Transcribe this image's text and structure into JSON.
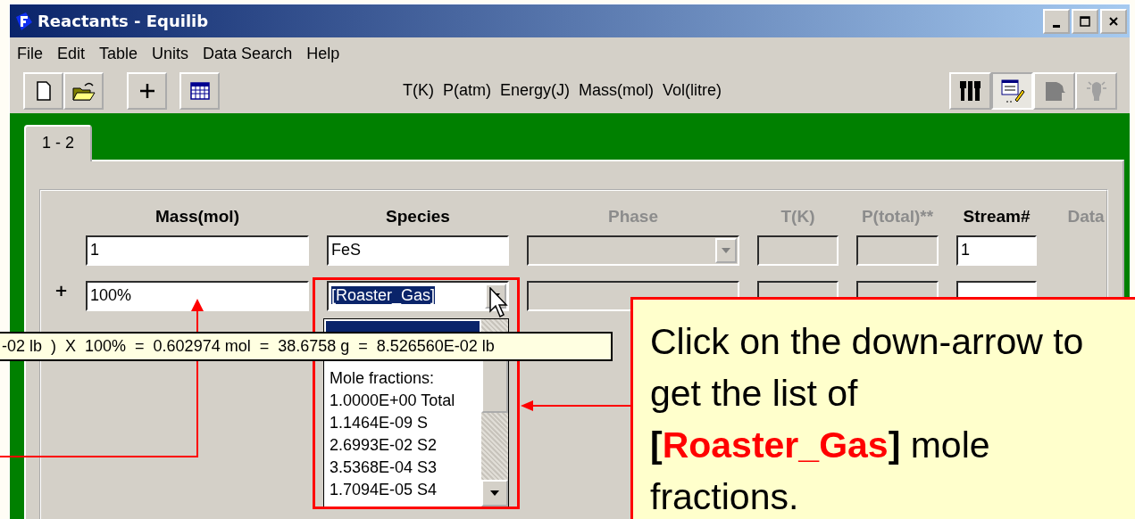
{
  "window": {
    "title": "Reactants - Equilib"
  },
  "menu": [
    {
      "label": "File"
    },
    {
      "label": "Edit"
    },
    {
      "label": "Table"
    },
    {
      "label": "Units"
    },
    {
      "label": "Data Search"
    },
    {
      "label": "Help"
    }
  ],
  "toolbar": {
    "units": "T(K)  P(atm)  Energy(J)  Mass(mol)  Vol(litre)",
    "right_buttons": [
      {
        "selected": false,
        "disabled": false
      },
      {
        "selected": true,
        "disabled": false
      },
      {
        "selected": false,
        "disabled": true
      },
      {
        "selected": false,
        "disabled": true
      }
    ]
  },
  "tabs": [
    {
      "label": "1 - 2",
      "selected": true
    }
  ],
  "columns": [
    {
      "label": "Mass(mol)",
      "disabled": false
    },
    {
      "label": "Species",
      "disabled": false
    },
    {
      "label": "Phase",
      "disabled": true
    },
    {
      "label": "T(K)",
      "disabled": true
    },
    {
      "label": "P(total)**",
      "disabled": true
    },
    {
      "label": "Stream#",
      "disabled": false
    },
    {
      "label": "Data",
      "disabled": true
    }
  ],
  "rows": [
    {
      "prefix": "",
      "mass": "1",
      "species": "FeS",
      "species_selected": false,
      "stream": "1"
    },
    {
      "prefix": "+",
      "mass": "100%",
      "species": "[Roaster_Gas]",
      "species_selected": true,
      "stream": ""
    }
  ],
  "dropdown": {
    "items": [
      "Mole fractions:",
      "1.0000E+00 Total",
      "1.1464E-09 S",
      "2.6993E-02 S2",
      "3.5368E-04 S3",
      "1.7094E-05 S4"
    ]
  },
  "tooltip": "-02 lb  )  X  100%  =  0.602974 mol  =  38.6758 g  =  8.526560E-02 lb",
  "callout": [
    {
      "text": "Click on the down-arrow to get the list of ",
      "kind": "plain"
    },
    {
      "text": "[",
      "kind": "bold"
    },
    {
      "text": "Roaster_Gas",
      "kind": "highlight"
    },
    {
      "text": "]",
      "kind": "bold"
    },
    {
      "text": " mole fractions.",
      "kind": "plain"
    }
  ]
}
